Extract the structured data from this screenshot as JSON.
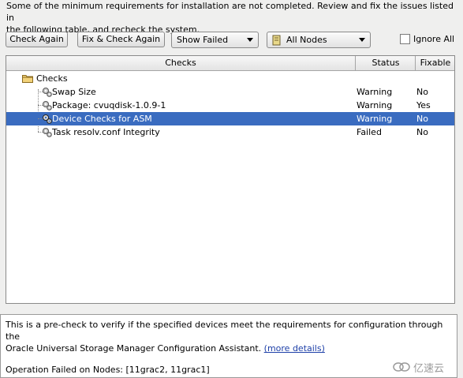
{
  "intro": {
    "line1": "Some of the minimum requirements for installation are not completed. Review and fix the issues listed in",
    "line2": "the following table, and recheck the system."
  },
  "toolbar": {
    "check_again_label": "Check Again",
    "fix_check_again_label": "Fix & Check Again",
    "show_filter_value": "Show Failed",
    "nodes_filter_value": "All Nodes",
    "ignore_all_label": "Ignore All"
  },
  "table": {
    "headers": {
      "checks": "Checks",
      "status": "Status",
      "fixable": "Fixable"
    },
    "root": "Checks",
    "rows": [
      {
        "name": "Swap Size",
        "status": "Warning",
        "fixable": "No"
      },
      {
        "name": "Package: cvuqdisk-1.0.9-1",
        "status": "Warning",
        "fixable": "Yes"
      },
      {
        "name": "Device Checks for ASM",
        "status": "Warning",
        "fixable": "No"
      },
      {
        "name": "Task resolv.conf Integrity",
        "status": "Failed",
        "fixable": "No"
      }
    ]
  },
  "description": {
    "line1": "This is a pre-check to verify if the specified devices meet the requirements for configuration through the",
    "line2": "Oracle Universal Storage Manager Configuration Assistant.",
    "more_details": "(more details)",
    "failed_nodes": "Operation Failed on Nodes: [11grac2, 11grac1]"
  },
  "watermark": {
    "text": "亿速云"
  }
}
